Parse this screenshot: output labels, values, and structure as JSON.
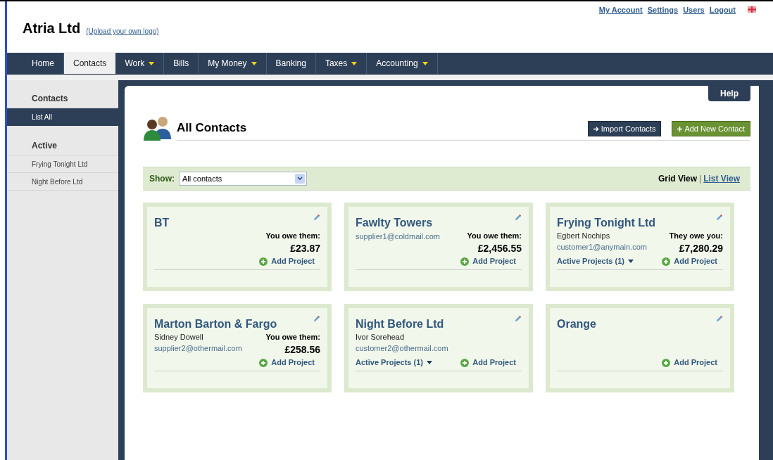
{
  "company": {
    "name": "Atria Ltd",
    "logo_link": "(Upload your own logo)"
  },
  "top_links": [
    "My Account",
    "Settings",
    "Users",
    "Logout"
  ],
  "nav": [
    {
      "label": "Home",
      "has_menu": false,
      "selected": false
    },
    {
      "label": "Contacts",
      "has_menu": false,
      "selected": true
    },
    {
      "label": "Work",
      "has_menu": true,
      "selected": false
    },
    {
      "label": "Bills",
      "has_menu": false,
      "selected": false
    },
    {
      "label": "My Money",
      "has_menu": true,
      "selected": false
    },
    {
      "label": "Banking",
      "has_menu": false,
      "selected": false
    },
    {
      "label": "Taxes",
      "has_menu": true,
      "selected": false
    },
    {
      "label": "Accounting",
      "has_menu": true,
      "selected": false
    }
  ],
  "sidebar": [
    {
      "heading": "Contacts",
      "items": [
        {
          "label": "List All",
          "selected": true
        }
      ]
    },
    {
      "heading": "Active",
      "items": [
        {
          "label": "Frying Tonight Ltd",
          "selected": false
        },
        {
          "label": "Night Before Ltd",
          "selected": false
        }
      ]
    }
  ],
  "help": "Help",
  "page_title": "All Contacts",
  "actions": {
    "import": "Import Contacts",
    "add": "Add New Contact"
  },
  "filter": {
    "label": "Show:",
    "value": "All contacts"
  },
  "view_separator": "|",
  "views": [
    {
      "label": "Grid View",
      "selected": true
    },
    {
      "label": "List View",
      "selected": false
    }
  ],
  "cards": [
    {
      "name": "BT",
      "balance_label": "You owe them:",
      "balance": "£23.87",
      "add_project": "Add Project"
    },
    {
      "name": "Fawlty Towers",
      "email": "supplier1@coldmail.com",
      "balance_label": "You owe them:",
      "balance": "£2,456.55",
      "add_project": "Add Project"
    },
    {
      "name": "Frying Tonight Ltd",
      "person": "Egbert Nochips",
      "email": "customer1@anymain.com",
      "balance_label": "They owe you:",
      "balance": "£7,280.29",
      "projects": "Active Projects (1)",
      "add_project": "Add Project"
    },
    {
      "name": "Marton Barton & Fargo",
      "person": "Sidney Dowell",
      "email": "supplier2@othermail.com",
      "balance_label": "You owe them:",
      "balance": "£258.56",
      "add_project": "Add Project"
    },
    {
      "name": "Night Before Ltd",
      "person": "Ivor Sorehead",
      "email": "customer2@othermail.com",
      "projects": "Active Projects (1)",
      "add_project": "Add Project"
    },
    {
      "name": "Orange",
      "add_project": "Add Project"
    }
  ]
}
